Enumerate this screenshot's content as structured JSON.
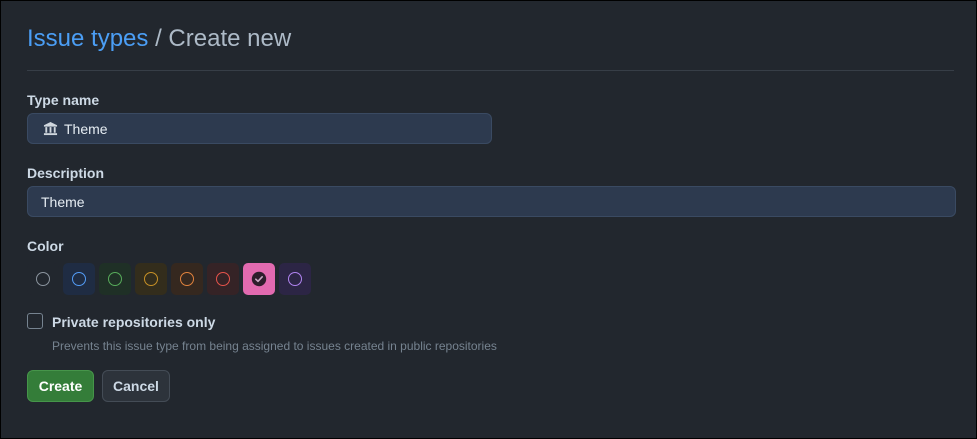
{
  "breadcrumb": {
    "parent": "Issue types",
    "separator": "/",
    "current": "Create new"
  },
  "form": {
    "type_name": {
      "label": "Type name",
      "value": "Theme",
      "icon": "bank-icon"
    },
    "description": {
      "label": "Description",
      "value": "Theme"
    },
    "color": {
      "label": "Color",
      "selected": "pink",
      "options": [
        {
          "name": "gray",
          "bg": "#22272e",
          "ring": "#8b949e"
        },
        {
          "name": "blue",
          "bg": "#1f2c43",
          "ring": "#539bf5"
        },
        {
          "name": "green",
          "bg": "#1f3026",
          "ring": "#57ab5a"
        },
        {
          "name": "yellow",
          "bg": "#332d1c",
          "ring": "#c69026"
        },
        {
          "name": "orange",
          "bg": "#35281f",
          "ring": "#e0823d"
        },
        {
          "name": "red",
          "bg": "#352326",
          "ring": "#e5534b"
        },
        {
          "name": "pink",
          "bg": "#e26ab0",
          "ring": "#2d1d2c"
        },
        {
          "name": "purple",
          "bg": "#2c2545",
          "ring": "#b083f0"
        }
      ]
    },
    "private_only": {
      "label": "Private repositories only",
      "hint": "Prevents this issue type from being assigned to issues created in public repositories",
      "checked": false
    }
  },
  "actions": {
    "create_label": "Create",
    "cancel_label": "Cancel"
  }
}
